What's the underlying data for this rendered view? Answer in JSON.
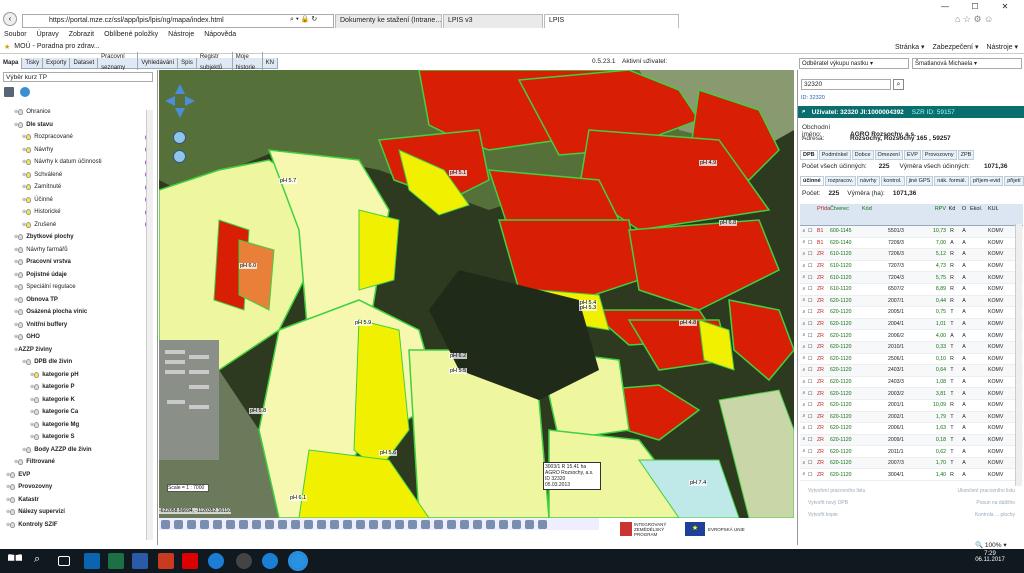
{
  "browser": {
    "url": "https://portal.mze.cz/ssl/app/lpis/lpis/ng/mapa/index.html",
    "tabs": [
      "Dokumenty ke stažení (Intrane...",
      "LPIS v3",
      "LPIS"
    ],
    "menu": [
      "Soubor",
      "Úpravy",
      "Zobrazit",
      "Oblíbené položky",
      "Nástroje",
      "Nápověda"
    ],
    "fav": "MOÚ - Poradna pro zdrav...",
    "cmd": [
      "Stránka ▾",
      "Zabezpečení ▾",
      "Nástroje ▾"
    ],
    "zoom": "100%"
  },
  "app": {
    "toolbar": [
      "Mapa",
      "Tisky",
      "Exporty",
      "Dataset",
      "Pracovní seznamy",
      "Vyhledávání",
      "Spis",
      "Registr subjektů",
      "Moje historie",
      "KN"
    ],
    "version": "0.5.23.1",
    "user_label": "Aktivní uživatel:",
    "right_select": "Odběratel výkupu nastku",
    "right_user": "Šmatlanová Michaela"
  },
  "left": {
    "layer_select": "Výběr kurz TP",
    "tree": [
      {
        "label": "Ohranice",
        "bold": false,
        "bulb": true,
        "on": false,
        "indent": 1
      },
      {
        "label": "Dle stavu",
        "bold": true,
        "bulb": true,
        "on": false,
        "indent": 1
      },
      {
        "label": "Rozpracované",
        "bold": false,
        "bulb": true,
        "on": true,
        "indent": 2
      },
      {
        "label": "Návrhy",
        "bold": false,
        "bulb": true,
        "on": true,
        "indent": 2
      },
      {
        "label": "Návrhy k datum účinnosti",
        "bold": false,
        "bulb": true,
        "on": true,
        "indent": 2
      },
      {
        "label": "Schválené",
        "bold": false,
        "bulb": true,
        "on": true,
        "indent": 2
      },
      {
        "label": "Zamítnuté",
        "bold": false,
        "bulb": true,
        "on": true,
        "indent": 2
      },
      {
        "label": "Účinné",
        "bold": false,
        "bulb": true,
        "on": true,
        "indent": 2
      },
      {
        "label": "Historické",
        "bold": false,
        "bulb": true,
        "on": true,
        "indent": 2
      },
      {
        "label": "Zrušené",
        "bold": false,
        "bulb": true,
        "on": true,
        "indent": 2
      },
      {
        "label": "Zbytkové plochy",
        "bold": true,
        "bulb": true,
        "on": false,
        "indent": 1
      },
      {
        "label": "Návrhy farmářů",
        "bold": false,
        "bulb": true,
        "on": false,
        "indent": 1
      },
      {
        "label": "Pracovní vrstva",
        "bold": true,
        "bulb": true,
        "on": false,
        "indent": 1
      },
      {
        "label": "Pojistné údaje",
        "bold": true,
        "bulb": true,
        "on": false,
        "indent": 1
      },
      {
        "label": "Speciální regulace",
        "bold": false,
        "bulb": true,
        "on": false,
        "indent": 1
      },
      {
        "label": "Obnova TP",
        "bold": true,
        "bulb": true,
        "on": false,
        "indent": 1
      },
      {
        "label": "Osázená plocha vinic",
        "bold": true,
        "bulb": true,
        "on": false,
        "indent": 1
      },
      {
        "label": "Vnitřní buffery",
        "bold": true,
        "bulb": true,
        "on": false,
        "indent": 1
      },
      {
        "label": "GHO",
        "bold": true,
        "bulb": true,
        "on": false,
        "indent": 1
      },
      {
        "label": "AZZP živiny",
        "bold": true,
        "bulb": false,
        "on": false,
        "indent": 1
      },
      {
        "label": "DPB dle živin",
        "bold": true,
        "bulb": true,
        "on": false,
        "indent": 2
      },
      {
        "label": "kategorie pH",
        "bold": true,
        "bulb": true,
        "on": true,
        "indent": 3
      },
      {
        "label": "kategorie P",
        "bold": true,
        "bulb": true,
        "on": false,
        "indent": 3
      },
      {
        "label": "kategorie K",
        "bold": true,
        "bulb": true,
        "on": false,
        "indent": 3
      },
      {
        "label": "kategorie Ca",
        "bold": true,
        "bulb": true,
        "on": false,
        "indent": 3
      },
      {
        "label": "kategorie Mg",
        "bold": true,
        "bulb": true,
        "on": false,
        "indent": 3
      },
      {
        "label": "kategorie S",
        "bold": true,
        "bulb": true,
        "on": false,
        "indent": 3
      },
      {
        "label": "Body AZZP dle živin",
        "bold": true,
        "bulb": true,
        "on": false,
        "indent": 2
      },
      {
        "label": "Filtrované",
        "bold": true,
        "bulb": true,
        "on": false,
        "indent": 1
      },
      {
        "label": "EVP",
        "bold": true,
        "bulb": true,
        "on": false,
        "indent": 0
      },
      {
        "label": "Provozovny",
        "bold": true,
        "bulb": true,
        "on": false,
        "indent": 0
      },
      {
        "label": "Katastr",
        "bold": true,
        "bulb": true,
        "on": false,
        "indent": 0
      },
      {
        "label": "Nálezy supervizí",
        "bold": true,
        "bulb": true,
        "on": false,
        "indent": 0
      },
      {
        "label": "Kontroly SZIF",
        "bold": true,
        "bulb": true,
        "on": false,
        "indent": 0
      }
    ]
  },
  "map": {
    "scale": "Scale = 1 : 7000",
    "coord": "-622058.56694, -1120352.16110",
    "info": [
      "3003/1 R 15.41 ha",
      "AGRO Rozsochy, a.s.",
      "ID 32320",
      "05.03.2013"
    ],
    "labels": [
      {
        "t": "pH 5.7"
      },
      {
        "t": "pH 6.0"
      },
      {
        "t": "pH 5.8"
      },
      {
        "t": "pH 6.2"
      },
      {
        "t": "pH 5.5"
      },
      {
        "t": "pH 5.9"
      },
      {
        "t": "pH 5.6"
      },
      {
        "t": "pH 7.4"
      },
      {
        "t": "pH 6.1"
      },
      {
        "t": "pH 5.4"
      },
      {
        "t": "pH 4.9"
      },
      {
        "t": "pH 5.1"
      },
      {
        "t": "pH 5.3"
      },
      {
        "t": "pH 4.8"
      },
      {
        "t": "pH 6.8"
      }
    ],
    "logo_texts": [
      "INTEGROVANÝ ZEMĚDĚLSKÝ PROGRAM",
      "EVROPSKÁ UNIE"
    ]
  },
  "right": {
    "search": "32320",
    "id_line": "ID: 32320",
    "header": "Uživatel: 32320 JI:1000004392",
    "szr": "SZR ID: 59157",
    "rows": [
      {
        "k": "Obchodní jméno:",
        "v": "AGRO Rozsochy, a.s."
      },
      {
        "k": "Adresa:",
        "v": "Rozsochy, Rozsochy 165 , 59257"
      }
    ],
    "tabs1": [
      "DPB",
      "Podmínkel",
      "Dobce",
      "Omezení",
      "EVP",
      "Provozovny",
      "ZPB"
    ],
    "count_all_label": "Počet všech účinných:",
    "count_all": "225",
    "area_all_label": "Výměra všech účinných:",
    "area_all": "1071,36",
    "tabs2": [
      "účinné",
      "rozpracov.",
      "návrhy",
      "kontrol.",
      "jiné GPS",
      "nák. formál.",
      "příjem-evid",
      "přijetí"
    ],
    "count_label": "Počet:",
    "count": "225",
    "area_label": "Výměra (ha):",
    "area": "1071,36",
    "columns": [
      "",
      "",
      "Přída",
      "Čtverec",
      "Kód",
      "",
      "RPV",
      "Kd",
      "O",
      "Ekol.",
      "KUL"
    ],
    "table": [
      [
        "B1",
        "600-1145",
        "5501/3",
        "10,73",
        "R",
        "KOMV"
      ],
      [
        "B1",
        "620-1140",
        "7209/3",
        "7,00",
        "A",
        "KOMV"
      ],
      [
        "ZR",
        "610-1120",
        "7206/3",
        "5,12",
        "R",
        "KOMV"
      ],
      [
        "ZR",
        "610-1120",
        "7207/3",
        "4,73",
        "R",
        "KOMV"
      ],
      [
        "ZR",
        "610-1120",
        "7204/3",
        "5,75",
        "R",
        "KOMV"
      ],
      [
        "ZR",
        "610-1120",
        "6507/2",
        "8,89",
        "R",
        "KOMV"
      ],
      [
        "ZR",
        "620-1120",
        "2007/1",
        "0,44",
        "R",
        "KOMV"
      ],
      [
        "ZR",
        "620-1120",
        "2005/1",
        "0,75",
        "T",
        "KOMV"
      ],
      [
        "ZR",
        "620-1120",
        "2004/1",
        "1,01",
        "T",
        "KOMV"
      ],
      [
        "ZR",
        "620-1120",
        "2006/2",
        "4,00",
        "A",
        "KOMV"
      ],
      [
        "ZR",
        "620-1120",
        "2010/1",
        "0,33",
        "T",
        "KOMV"
      ],
      [
        "ZR",
        "620-1120",
        "2506/1",
        "0,10",
        "R",
        "KOMV"
      ],
      [
        "ZR",
        "620-1120",
        "2403/1",
        "0,64",
        "T",
        "KOMV"
      ],
      [
        "ZR",
        "620-1120",
        "2403/3",
        "1,08",
        "T",
        "KOMV"
      ],
      [
        "ZR",
        "620-1120",
        "2003/2",
        "3,81",
        "T",
        "KOMV"
      ],
      [
        "ZR",
        "620-1120",
        "2001/1",
        "10,09",
        "R",
        "KOMV"
      ],
      [
        "ZR",
        "620-1120",
        "2002/1",
        "1,79",
        "T",
        "KOMV"
      ],
      [
        "ZR",
        "620-1120",
        "2006/1",
        "1,63",
        "T",
        "KOMV"
      ],
      [
        "ZR",
        "620-1120",
        "2009/1",
        "0,18",
        "T",
        "KOMV"
      ],
      [
        "ZR",
        "620-1120",
        "2011/1",
        "0,62",
        "T",
        "KOMV"
      ],
      [
        "ZR",
        "620-1120",
        "2007/3",
        "1,70",
        "T",
        "KOMV"
      ],
      [
        "ZR",
        "620-1120",
        "3004/1",
        "1,40",
        "R",
        "KOMV"
      ]
    ],
    "footer": [
      [
        "Vytvoření pracovního listu",
        "Ukončení pracovního listu"
      ],
      [
        "Vytvořit nový DPB",
        "Posun na dalšího"
      ],
      [
        "Vytvořit kopie",
        "Kontrola ... plochy"
      ]
    ]
  },
  "taskbar": {
    "time": "7:29",
    "date": "06.11.2017"
  }
}
